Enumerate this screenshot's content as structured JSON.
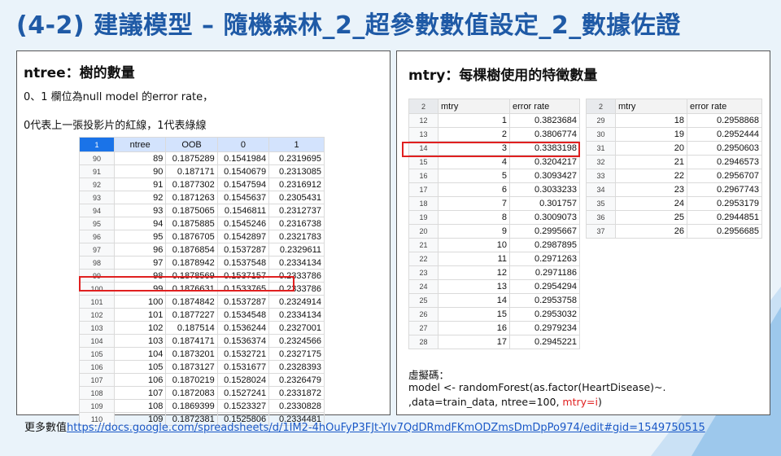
{
  "title": "(4-2) 建議模型 – 隨機森林_2_超參數數值設定_2_數據佐證",
  "left_panel": {
    "heading": "ntree：樹的數量",
    "note1": "0、1 欄位為null model 的error rate，",
    "note2": "0代表上一張投影片的紅線，1代表綠線",
    "header": [
      "1",
      "ntree",
      "OOB",
      "0",
      "1"
    ],
    "rows": [
      [
        "90",
        "89",
        "0.1875289",
        "0.1541984",
        "0.2319695"
      ],
      [
        "91",
        "90",
        "0.187171",
        "0.1540679",
        "0.2313085"
      ],
      [
        "92",
        "91",
        "0.1877302",
        "0.1547594",
        "0.2316912"
      ],
      [
        "93",
        "92",
        "0.1871263",
        "0.1545637",
        "0.2305431"
      ],
      [
        "94",
        "93",
        "0.1875065",
        "0.1546811",
        "0.2312737"
      ],
      [
        "95",
        "94",
        "0.1875885",
        "0.1545246",
        "0.2316738"
      ],
      [
        "96",
        "95",
        "0.1876705",
        "0.1542897",
        "0.2321783"
      ],
      [
        "97",
        "96",
        "0.1876854",
        "0.1537287",
        "0.2329611"
      ],
      [
        "98",
        "97",
        "0.1878942",
        "0.1537548",
        "0.2334134"
      ],
      [
        "99",
        "98",
        "0.1878569",
        "0.1537157",
        "0.2333786"
      ],
      [
        "100",
        "99",
        "0.1876631",
        "0.1533765",
        "0.2333786"
      ],
      [
        "101",
        "100",
        "0.1874842",
        "0.1537287",
        "0.2324914"
      ],
      [
        "102",
        "101",
        "0.1877227",
        "0.1534548",
        "0.2334134"
      ],
      [
        "103",
        "102",
        "0.187514",
        "0.1536244",
        "0.2327001"
      ],
      [
        "104",
        "103",
        "0.1874171",
        "0.1536374",
        "0.2324566"
      ],
      [
        "105",
        "104",
        "0.1873201",
        "0.1532721",
        "0.2327175"
      ],
      [
        "106",
        "105",
        "0.1873127",
        "0.1531677",
        "0.2328393"
      ],
      [
        "107",
        "106",
        "0.1870219",
        "0.1528024",
        "0.2326479"
      ],
      [
        "108",
        "107",
        "0.1872083",
        "0.1527241",
        "0.2331872"
      ],
      [
        "109",
        "108",
        "0.1869399",
        "0.1523327",
        "0.2330828"
      ],
      [
        "110",
        "109",
        "0.1872381",
        "0.1525806",
        "0.2334481"
      ]
    ]
  },
  "right_panel": {
    "heading": "mtry：每棵樹使用的特徵數量",
    "table1": {
      "header": [
        "2",
        "mtry",
        "error rate"
      ],
      "rows": [
        [
          "12",
          "1",
          "0.3823684"
        ],
        [
          "13",
          "2",
          "0.3806774"
        ],
        [
          "14",
          "3",
          "0.3383198"
        ],
        [
          "15",
          "4",
          "0.3204217"
        ],
        [
          "16",
          "5",
          "0.3093427"
        ],
        [
          "17",
          "6",
          "0.3033233"
        ],
        [
          "18",
          "7",
          "0.301757"
        ],
        [
          "19",
          "8",
          "0.3009073"
        ],
        [
          "20",
          "9",
          "0.2995667"
        ],
        [
          "21",
          "10",
          "0.2987895"
        ],
        [
          "22",
          "11",
          "0.2971263"
        ],
        [
          "23",
          "12",
          "0.2971186"
        ],
        [
          "24",
          "13",
          "0.2954294"
        ],
        [
          "25",
          "14",
          "0.2953758"
        ],
        [
          "26",
          "15",
          "0.2953032"
        ],
        [
          "27",
          "16",
          "0.2979234"
        ],
        [
          "28",
          "17",
          "0.2945221"
        ]
      ]
    },
    "table2": {
      "header": [
        "2",
        "mtry",
        "error rate"
      ],
      "rows": [
        [
          "29",
          "18",
          "0.2958868"
        ],
        [
          "30",
          "19",
          "0.2952444"
        ],
        [
          "31",
          "20",
          "0.2950603"
        ],
        [
          "32",
          "21",
          "0.2946573"
        ],
        [
          "33",
          "22",
          "0.2956707"
        ],
        [
          "34",
          "23",
          "0.2967743"
        ],
        [
          "35",
          "24",
          "0.2953179"
        ],
        [
          "36",
          "25",
          "0.2944851"
        ],
        [
          "37",
          "26",
          "0.2956685"
        ]
      ]
    },
    "code_label": "虛擬碼：",
    "code_line1": "model <- randomForest(as.factor(HeartDisease)~.",
    "code_line2_prefix": ",data=train_data, ntree=100, ",
    "code_line2_highlight": "mtry=i",
    "code_line2_suffix": ")"
  },
  "footer": {
    "label": "更多數值",
    "link": "https://docs.google.com/spreadsheets/d/1IM2-4hOuFyP3FJt-YIv7QdDRmdFKmODZmsDmDpPo974/edit#gid=1549750515"
  },
  "colors": {
    "title": "#1f5aa6",
    "highlight": "#e02020",
    "link": "#1a58c7"
  }
}
